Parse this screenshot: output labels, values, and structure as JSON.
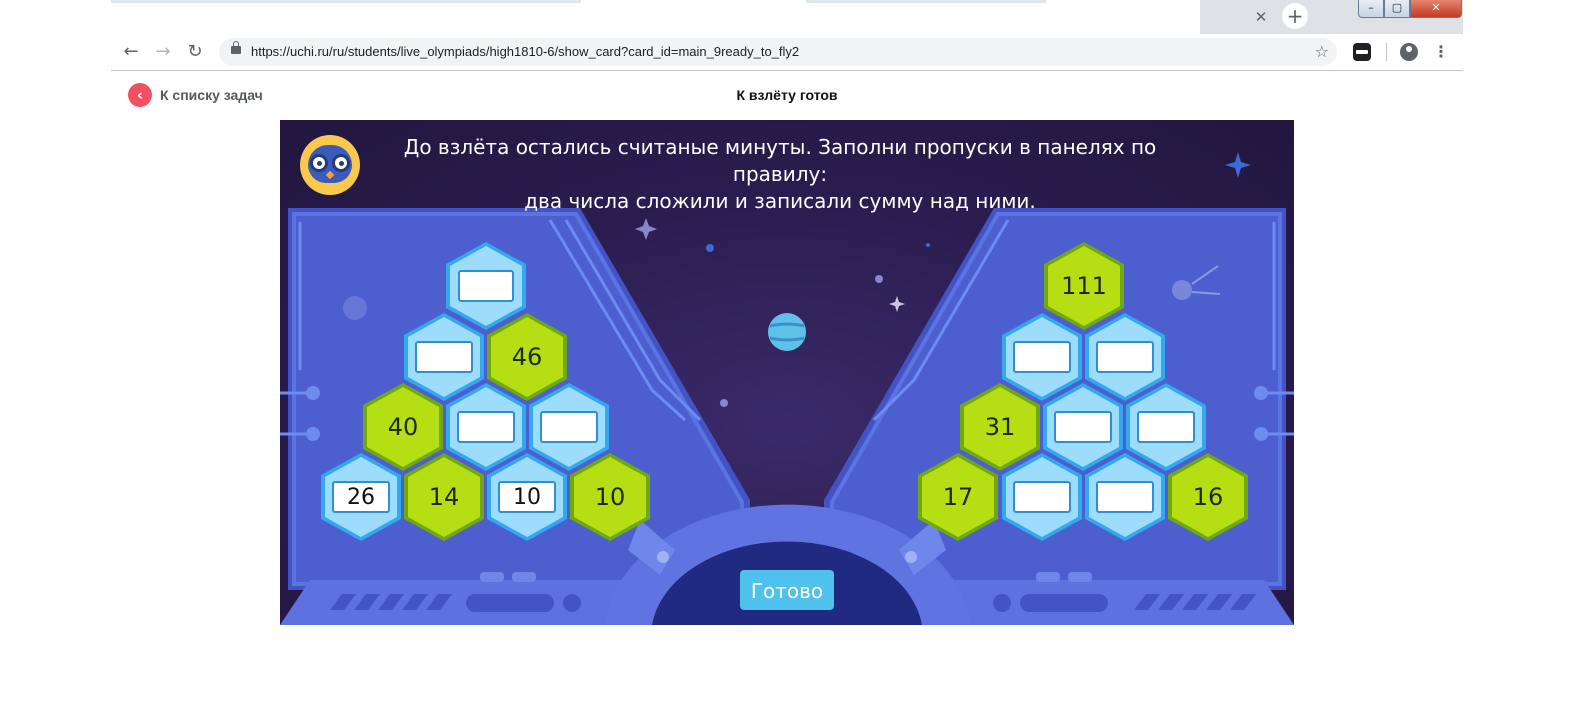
{
  "browser": {
    "url": "https://uchi.ru/ru/students/live_olympiads/high1810-6/show_card?card_id=main_9ready_to_fly2",
    "icons": [
      "back-arrow-icon",
      "forward-arrow-icon",
      "reload-icon",
      "lock-icon",
      "star-icon",
      "extension-icon",
      "profile-icon",
      "menu-icon",
      "close-icon",
      "plus-icon"
    ]
  },
  "header": {
    "back_label": "К списку задач",
    "page_title": "К взлёту готов"
  },
  "task": {
    "instruction_line1": "До взлёта остались считаные минуты. Заполни пропуски в панелях по правилу:",
    "instruction_line2": "два числа сложили и записали сумму над ними.",
    "done_label": "Готово",
    "left_pyramid": {
      "row1": [
        "",
        ""
      ],
      "row2": [
        "",
        "46"
      ],
      "row3": [
        "40",
        "",
        ""
      ],
      "row4": [
        "26",
        "14",
        "10",
        "10"
      ]
    },
    "right_pyramid": {
      "row1": [
        "111"
      ],
      "row2": [
        "",
        ""
      ],
      "row3": [
        "31",
        "",
        ""
      ],
      "row4": [
        "17",
        "",
        "",
        "16"
      ]
    },
    "colors": {
      "green_hex": "#b5df13",
      "blue_hex": "#9ddcfa",
      "panel": "#4a58c8",
      "space": "#2a1c4e",
      "done_button": "#4fc1ec",
      "back_button": "#f0505f"
    }
  }
}
